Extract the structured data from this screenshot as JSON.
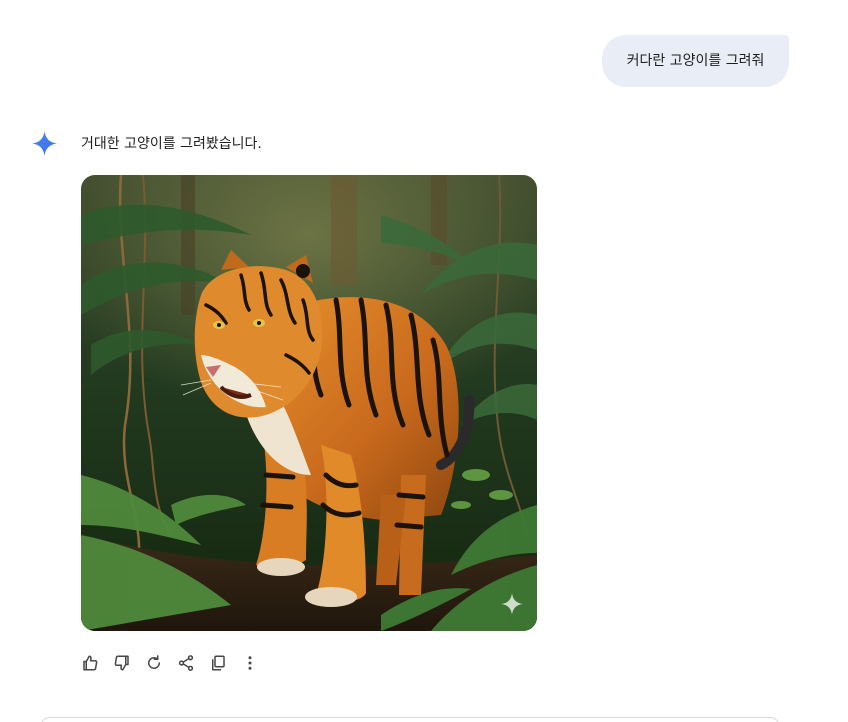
{
  "conversation": {
    "user_message": "커다란 고양이를 그려줘",
    "model_response": "거대한 고양이를 그려봤습니다.",
    "model_icon": "sparkle-icon",
    "image_icon": "watermark-sparkle-icon"
  },
  "actions": [
    {
      "name": "thumbs-up-icon"
    },
    {
      "name": "thumbs-down-icon"
    },
    {
      "name": "regenerate-icon"
    },
    {
      "name": "share-icon"
    },
    {
      "name": "copy-icon"
    },
    {
      "name": "more-options-icon"
    }
  ],
  "colors": {
    "bubble": "#e9eef6",
    "accent": "#4a86f7",
    "icon": "#444746"
  }
}
